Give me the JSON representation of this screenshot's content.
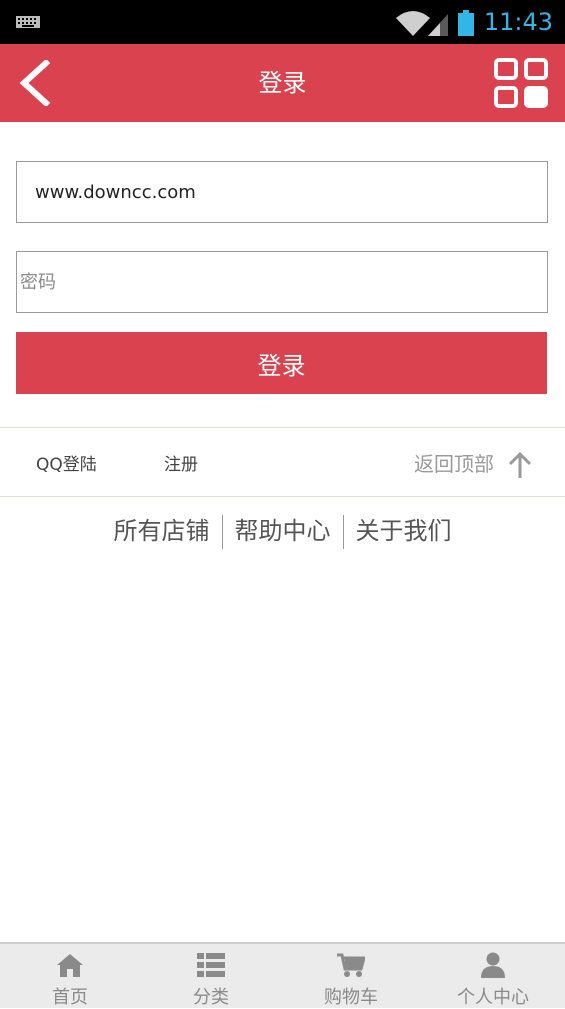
{
  "status_bar": {
    "time": "11:43",
    "time_color": "#33b5e5"
  },
  "header": {
    "title": "登录",
    "background": "#d9424e",
    "back_icon": "chevron-left-icon",
    "menu_icon": "grid-icon"
  },
  "form": {
    "username_value": "www.downcc.com",
    "password_placeholder": "密码",
    "login_label": "登录"
  },
  "links": {
    "qq_login": "QQ登陆",
    "register": "注册",
    "back_to_top": "返回顶部"
  },
  "footer_links": [
    "所有店铺",
    "帮助中心",
    "关于我们"
  ],
  "bottom_nav": [
    {
      "label": "首页",
      "icon": "home-icon"
    },
    {
      "label": "分类",
      "icon": "list-icon"
    },
    {
      "label": "购物车",
      "icon": "cart-icon"
    },
    {
      "label": "个人中心",
      "icon": "user-icon"
    }
  ]
}
